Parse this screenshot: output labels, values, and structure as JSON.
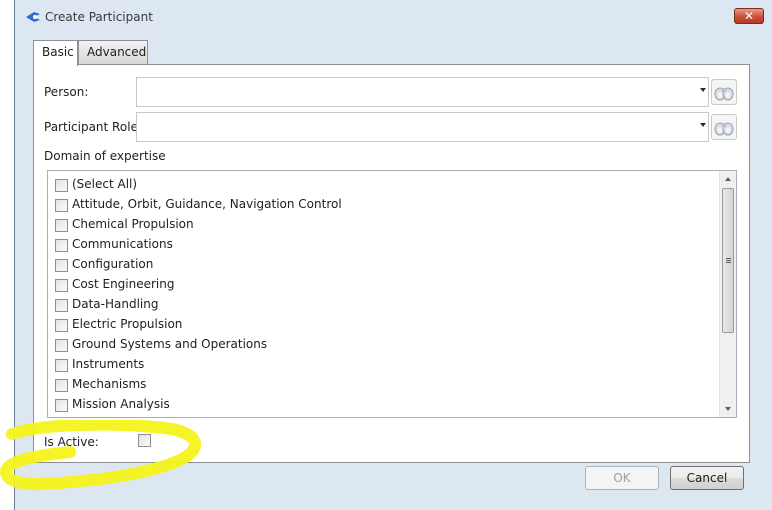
{
  "window": {
    "title": "Create Participant",
    "close_label": "✕"
  },
  "tabs": [
    {
      "label": "Basic",
      "active": true
    },
    {
      "label": "Advanced",
      "active": false
    }
  ],
  "form": {
    "person_label": "Person:",
    "person_value": "",
    "role_label": "Participant Role:",
    "role_value": "",
    "domain_label": "Domain of expertise",
    "is_active_label": "Is Active:",
    "is_active_checked": false
  },
  "domains": [
    {
      "label": "(Select All)",
      "checked": false
    },
    {
      "label": "Attitude, Orbit, Guidance, Navigation Control",
      "checked": false
    },
    {
      "label": "Chemical Propulsion",
      "checked": false
    },
    {
      "label": "Communications",
      "checked": false
    },
    {
      "label": "Configuration",
      "checked": false
    },
    {
      "label": "Cost Engineering",
      "checked": false
    },
    {
      "label": "Data-Handling",
      "checked": false
    },
    {
      "label": "Electric Propulsion",
      "checked": false
    },
    {
      "label": "Ground Systems and Operations",
      "checked": false
    },
    {
      "label": "Instruments",
      "checked": false
    },
    {
      "label": "Mechanisms",
      "checked": false
    },
    {
      "label": "Mission Analysis",
      "checked": false
    }
  ],
  "buttons": {
    "ok_label": "OK",
    "ok_enabled": false,
    "cancel_label": "Cancel"
  },
  "icons": {
    "app": "app-logo-icon",
    "search": "binoculars-icon",
    "dropdown": "chevron-down-icon",
    "scroll_up": "scroll-up-arrow-icon",
    "scroll_down": "scroll-down-arrow-icon"
  },
  "colors": {
    "highlight": "#f3f31a",
    "window_bg": "#dde7f1",
    "close": "#c9503a"
  }
}
